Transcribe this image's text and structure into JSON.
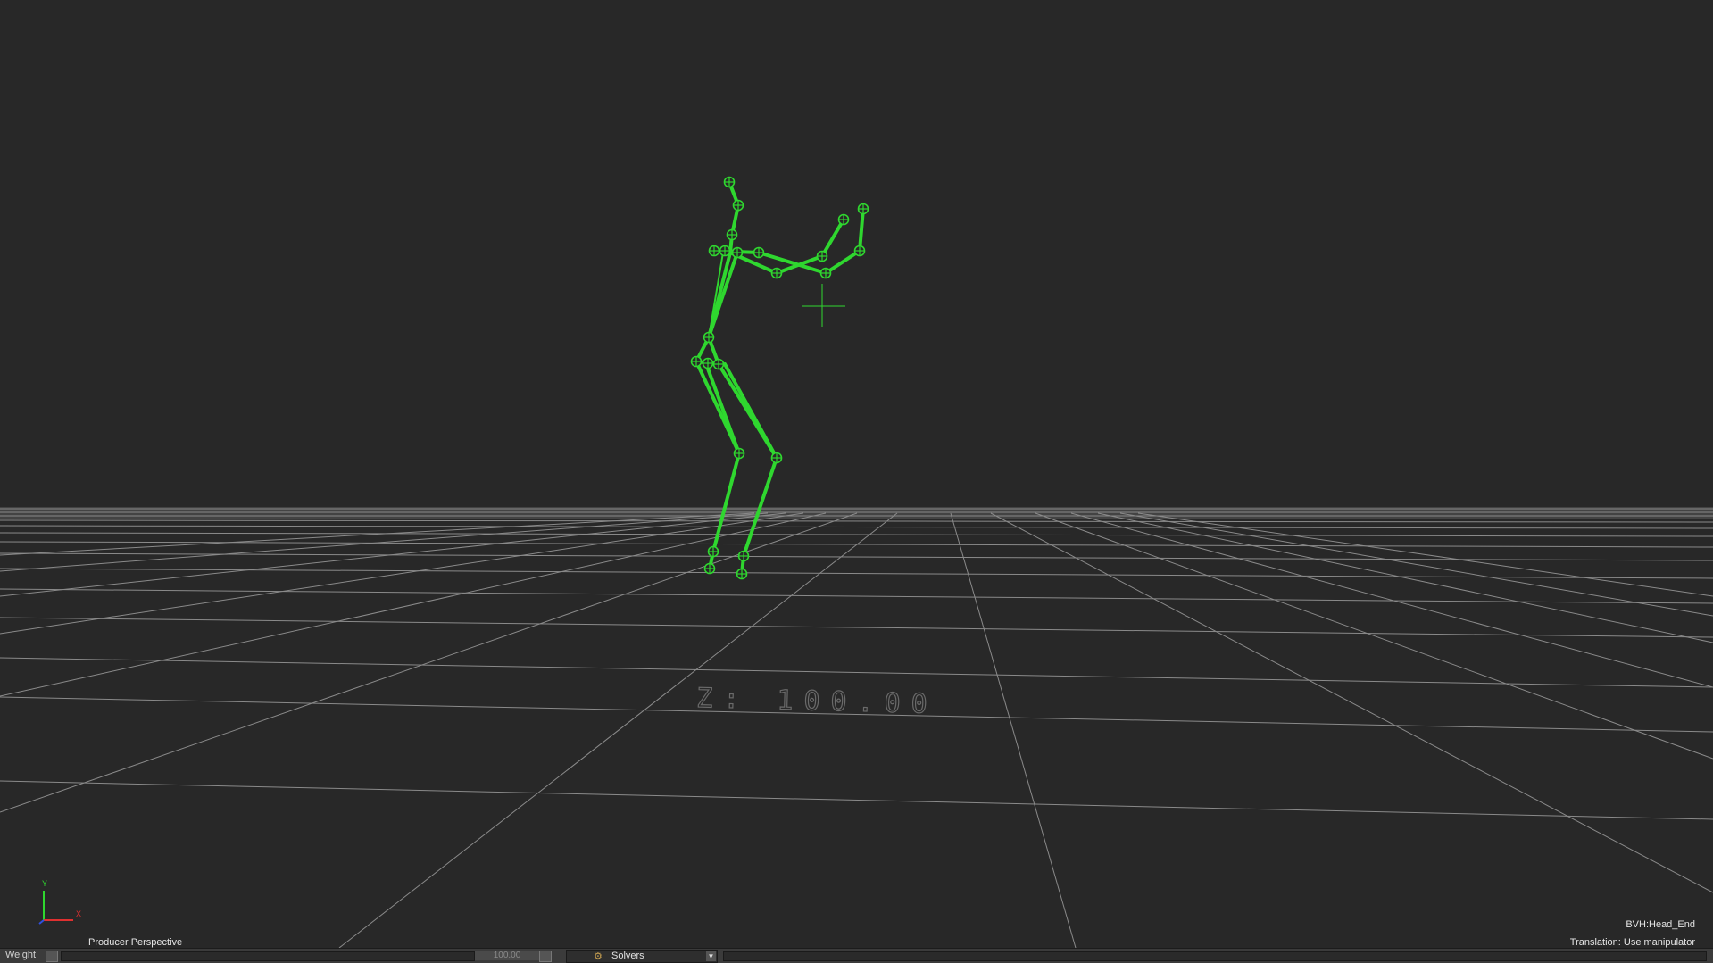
{
  "viewport": {
    "camera_label": "Producer Perspective",
    "selected_object": "BVH:Head_End",
    "manipulator_mode": "Translation: Use manipulator",
    "ground_label": "Z: 100.00",
    "axis": {
      "y_label": "Y",
      "x_label": "X"
    }
  },
  "statusbar": {
    "weight_label": "Weight",
    "weight_value": "100.00",
    "solvers_label": "Solvers",
    "solvers_icon": "solver-icon"
  },
  "colors": {
    "background": "#282828",
    "skeleton": "#2fd72f",
    "grid": "#8a8a8a"
  }
}
